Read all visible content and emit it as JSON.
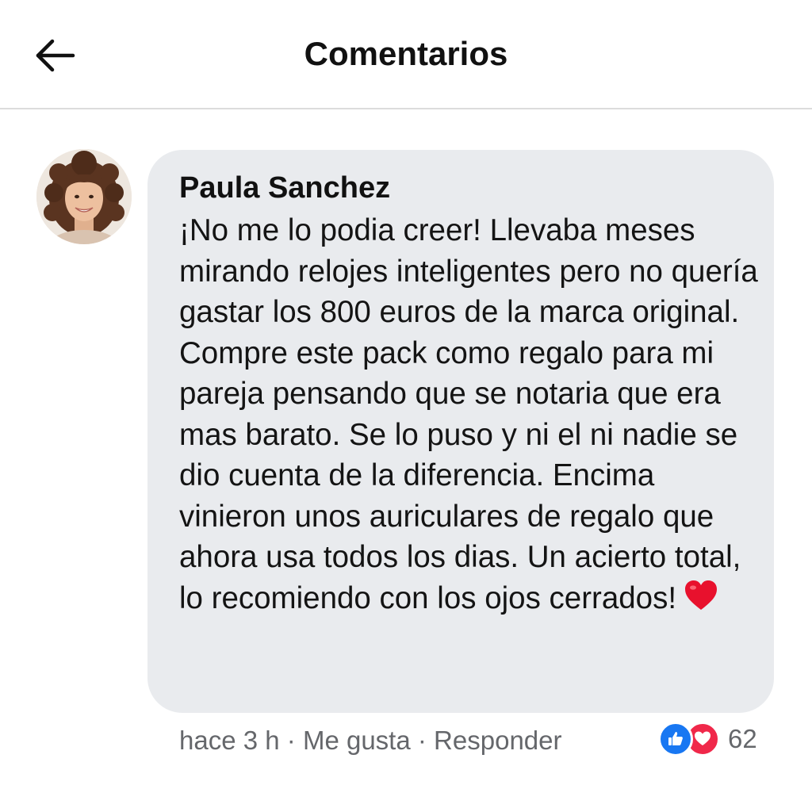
{
  "header": {
    "title": "Comentarios",
    "back_icon": "arrow-left-icon"
  },
  "comment": {
    "author": "Paula Sanchez",
    "avatar_icon": "user-avatar",
    "text": "¡No me lo podia creer! Llevaba meses mirando relojes inteligentes pero no quería gastar los 800 euros de la marca original. Compre este pack como regalo para mi pareja pensando que se notaria que era mas barato. Se lo puso y ni el ni nadie se dio cuenta de la diferencia. Encima vinieron unos auriculares de regalo que ahora usa todos los dias. Un acierto total, lo recomiendo con los ojos cerrados!",
    "emoji": "red-heart-emoji",
    "time": "hace 3 h",
    "separator": "·",
    "like_label": "Me gusta",
    "reply_label": "Responder",
    "reaction_count": "62",
    "reactions": [
      "like",
      "love"
    ]
  },
  "colors": {
    "bubble_bg": "#e9ebee",
    "meta_text": "#65676b",
    "like_blue": "#1877f2",
    "love_red": "#f0284a",
    "divider": "#dcdcdc"
  }
}
